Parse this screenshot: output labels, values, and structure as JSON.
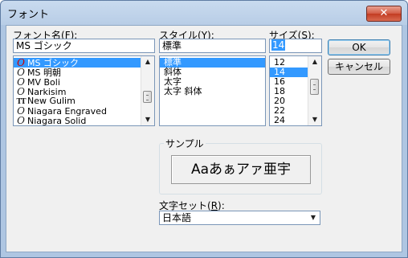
{
  "window": {
    "title": "フォント",
    "close_label": "✕"
  },
  "font": {
    "label_prefix": "フォント名(",
    "label_key": "F",
    "label_suffix": "):",
    "value": "MS ゴシック",
    "items": [
      {
        "label": "MS ゴシック",
        "icon": "O",
        "icon_type": "opentype",
        "selected": true
      },
      {
        "label": "MS 明朝",
        "icon": "O",
        "icon_type": "opentype",
        "selected": false
      },
      {
        "label": "MV Boli",
        "icon": "O",
        "icon_type": "opentype",
        "selected": false
      },
      {
        "label": "Narkisim",
        "icon": "O",
        "icon_type": "opentype",
        "selected": false
      },
      {
        "label": "New Gulim",
        "icon": "TT",
        "icon_type": "truetype",
        "selected": false
      },
      {
        "label": "Niagara Engraved",
        "icon": "O",
        "icon_type": "opentype",
        "selected": false
      },
      {
        "label": "Niagara Solid",
        "icon": "O",
        "icon_type": "opentype",
        "selected": false
      }
    ]
  },
  "style": {
    "label_prefix": "スタイル(",
    "label_key": "Y",
    "label_suffix": "):",
    "value": "標準",
    "items": [
      {
        "label": "標準",
        "selected": true
      },
      {
        "label": "斜体",
        "selected": false
      },
      {
        "label": "太字",
        "selected": false
      },
      {
        "label": "太字 斜体",
        "selected": false
      }
    ]
  },
  "size": {
    "label_prefix": "サイズ(",
    "label_key": "S",
    "label_suffix": "):",
    "value": "14",
    "items": [
      {
        "label": "12",
        "selected": false
      },
      {
        "label": "14",
        "selected": true
      },
      {
        "label": "16",
        "selected": false
      },
      {
        "label": "18",
        "selected": false
      },
      {
        "label": "20",
        "selected": false
      },
      {
        "label": "22",
        "selected": false
      },
      {
        "label": "24",
        "selected": false
      }
    ]
  },
  "buttons": {
    "ok_label": "OK",
    "cancel_label": "キャンセル"
  },
  "sample": {
    "group_label": "サンプル",
    "text": "Aaあぁアァ亜宇"
  },
  "charset": {
    "label_prefix": "文字セット(",
    "label_key": "R",
    "label_suffix": "):",
    "value": "日本語"
  },
  "icons": {
    "scroll_up": "▲",
    "scroll_down": "▼",
    "dropdown": "▼"
  }
}
